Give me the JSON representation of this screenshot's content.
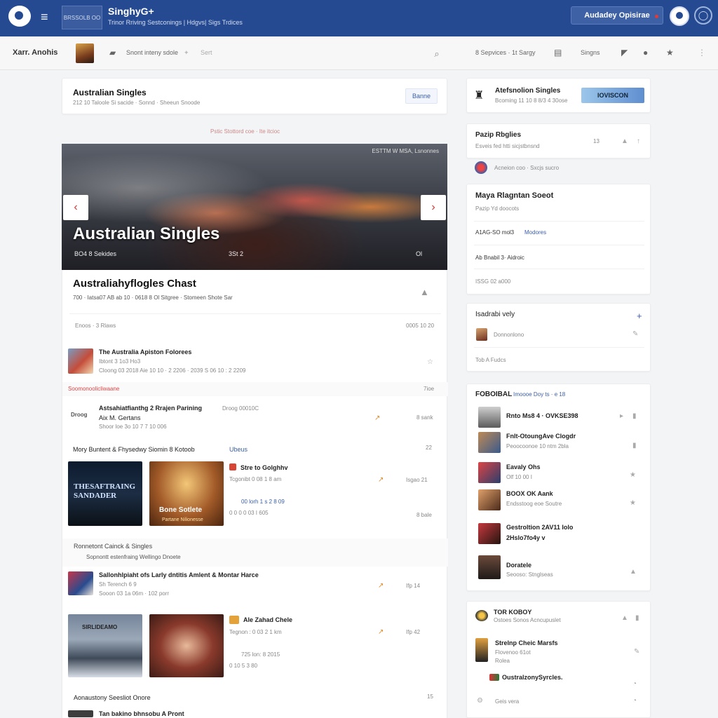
{
  "topbar": {
    "brand_box": "BRSSOLB OO",
    "title": "SinghyG+",
    "tagline": "Trinor Rriving Sestconings | Hdgvs| Sigs Trdices",
    "cta": "Audadey Opisirae"
  },
  "subbar": {
    "name": "Xarr. Anohis",
    "crumb": "Snont inteny sdole",
    "sort": "Sert",
    "stat": "8 Sepvices · 1t Sargy",
    "signs": "Singns"
  },
  "main": {
    "head_card": {
      "title": "Australian Singles",
      "sub": "212 10 Taloole Si sacide · Sonnd · Sheeun Snoode",
      "button": "Banne"
    },
    "feed_label": "Pstic Stottord  coe  · Ite itcioc",
    "hero": {
      "tag": "ESTTM W MSA, Lsnonnes",
      "title": "Australian Singles",
      "meta_left": "BO4 8 Sekides",
      "meta_mid": "3St 2",
      "meta_right": "Ol"
    },
    "chart_card": {
      "title": "Australiahyflogles Chast",
      "meta": "700 · Iatsa07 AB ab 10 · 0618 8 Ol Sitgree · Stomeen Shote Sar",
      "filter": "Enoos · 3 Rlaws",
      "date": "0005 10 20"
    },
    "items": [
      {
        "title": "The Australia Apiston Folorees",
        "sub1": "Ibtont 3 1o3 Ho3",
        "sub2": "Cloong 03 2018 Aie 10 10 · 2 2206 · 2039 S 06 10 : 2 2209"
      },
      {
        "section": "Soomonoolicliwaane",
        "right": "7ioe"
      },
      {
        "title": "Astsahiatfianthg 2 Rrajen Parining",
        "tag": "Droog 00010C",
        "sub1": "Aix M. Gertans",
        "sub2": "Shoor loe 3o 10 7 7 10 006",
        "left_badge": "Droog",
        "right": "8 sank"
      },
      {
        "section": "Mory Buntent & Fhysedwy Siomin 8 Kotoob",
        "link": "Ubeus",
        "count": "22"
      },
      {
        "card1": "THESAFTRAING SANDADER",
        "card2": "Bone Sotlete",
        "card2_sub": "Partane Nilionesse",
        "title": "Stre to Golghhv",
        "sub1": "Tcgonibt 0 08 1 8 am",
        "link_line": "00 lorh 1 s 2 8 09",
        "sub2": "0 0 0 0 03 I 605",
        "right1": "Isgao 21",
        "right2": "8 bale"
      },
      {
        "section": "Ronnetont Cainck & Singles",
        "sub": "Sopnontt estenfraing Wellingo Dnoete"
      },
      {
        "title": "Sallonhlpiaht ofs Larly dntitis Amlent & Montar Harce",
        "sub1": "Sh Terench 6 9",
        "sub2": "Sooon 03 1a 06m · 102 porr",
        "right": "Ifp 14"
      },
      {
        "card1": "SIRLIDEAMO",
        "title": "Ale Zahad Chele",
        "sub1": "Tegnon : 0 03 2 1 km",
        "sub2": "725 lon: 8 2015",
        "sub3": "0 10 5 3 80",
        "right": "Ifp 42"
      },
      {
        "section": "Aonaustony Seesliot  Onore",
        "count": "15"
      },
      {
        "title": "Tan bakino bhnsobu A Pront"
      }
    ]
  },
  "right": {
    "top_card": {
      "title": "Atefsnolion Singles",
      "sub": "Bcoming 11 10 8 8/3 4 30ose",
      "badge": "IOVISCON"
    },
    "popular": {
      "title": "Pazip Rbglies",
      "sub": "Esveis fed htti sicjstbnsnd",
      "count": "13",
      "user_line": "Acneion coo · Sxcjs sucro"
    },
    "maya": {
      "title": "Maya Rlagntan Soeot",
      "sub": "Pazip Yd doocots",
      "row1": "A1AG-SO mol3",
      "row1_link": "Modores",
      "row2": "Ab Bnabil 3· Aidroic",
      "row3": "ISSG 02 a000"
    },
    "isadra": {
      "title": "Isadrabi vely",
      "row1": "Donnonlono",
      "row2": "Tob A Fudcs"
    },
    "chart_list": {
      "title": "FOBOIBAL",
      "subtitle": "Imoooe  Doy ts · e 18",
      "items": [
        {
          "title": "Rnto Ms8 4 · OVKSE398",
          "sub": ""
        },
        {
          "title": "Fnlt-OtoungAve Clogdr",
          "sub": "Peoocoonoe 10 ntm 2bla"
        },
        {
          "title": "Eavaly Ohs",
          "sub": "Olf 10 00 I"
        },
        {
          "title": "BOOX OK Aank",
          "sub": "Endsstoog eoe Soutre"
        },
        {
          "title": "Gestroltion 2AV11 lolo",
          "sub": "2Hslo7fo4y v"
        },
        {
          "title": "Doratele",
          "sub": "Seooso: Stnglseas"
        }
      ]
    },
    "bottom": {
      "title": "TOR KOBOY",
      "sub": "Ostoes Sonos Acncupuslet",
      "item1": "Strelnp Cheic Marsfs",
      "item1_sub": "Flovenoo 61ot",
      "item1_sub2": "Rolea",
      "item2": "OustralzonySyrcles.",
      "item3": "Geis vera"
    }
  },
  "colors": {
    "primary": "#254a92",
    "accent": "#e53935",
    "link": "#3a5ea8"
  }
}
